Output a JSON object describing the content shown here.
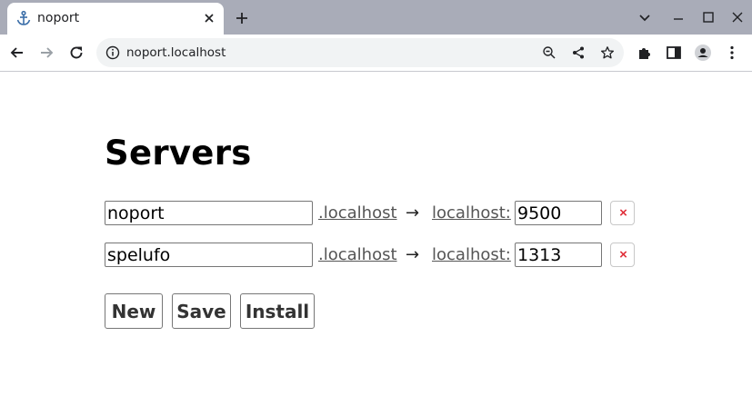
{
  "browser": {
    "tab_title": "noport",
    "url": "noport.localhost",
    "icons": {
      "favicon": "anchor-icon",
      "tab_close": "close-icon",
      "new_tab": "plus-icon",
      "back": "arrow-left-icon",
      "forward": "arrow-right-icon",
      "reload": "reload-icon",
      "site_info": "info-icon",
      "zoom": "zoom-out-icon",
      "share": "share-icon",
      "bookmark": "star-icon",
      "extensions": "puzzle-icon",
      "side_panel": "side-panel-icon",
      "profile": "profile-icon",
      "menu": "kebab-menu-icon"
    }
  },
  "page": {
    "title": "Servers",
    "servers": [
      {
        "name": "noport",
        "suffix": ".localhost",
        "arrow": "→",
        "target_host": "localhost:",
        "port": "9500",
        "remove_label": "×"
      },
      {
        "name": "spelufo",
        "suffix": ".localhost",
        "arrow": "→",
        "target_host": "localhost:",
        "port": "1313",
        "remove_label": "×"
      }
    ],
    "actions": {
      "new_label": "New",
      "save_label": "Save",
      "install_label": "Install"
    }
  },
  "colors": {
    "tabstrip": "#a9acb8",
    "link": "#555555",
    "remove": "#e0303a"
  }
}
